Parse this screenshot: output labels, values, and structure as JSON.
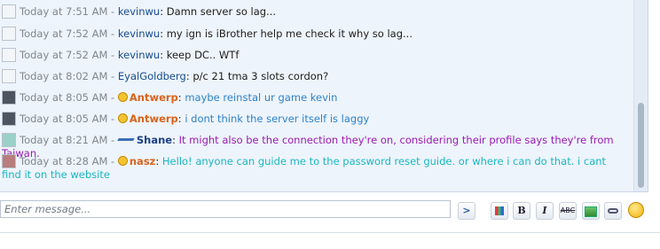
{
  "messages": [
    {
      "time": "Today at 7:51 AM",
      "user": "kevinwu",
      "text": "Damn server so lag..."
    },
    {
      "time": "Today at 7:52 AM",
      "user": "kevinwu",
      "text": "my ign is iBrother help me check it why so lag..."
    },
    {
      "time": "Today at 7:52 AM",
      "user": "kevinwu",
      "text": "keep DC.. WTf"
    },
    {
      "time": "Today at 8:02 AM",
      "user": "EyalGoldberg",
      "text": "p/c 21 tma 3 slots cordon?"
    },
    {
      "time": "Today at 8:05 AM",
      "user": "Antwerp",
      "text": "maybe reinstal ur game kevin"
    },
    {
      "time": "Today at 8:05 AM",
      "user": "Antwerp",
      "text": "i dont think the server itself is laggy"
    },
    {
      "time": "Today at 8:21 AM",
      "user": "Shane",
      "text": "It might also be the connection they're on, considering their profile says they're from Taiwan."
    },
    {
      "time": "Today at 8:28 AM",
      "user": "nasz",
      "text": "Hello! anyone can guide me to the password reset guide. or where i can do that. i cant find it on the website"
    }
  ],
  "separator": " - ",
  "colon": ": ",
  "input": {
    "placeholder": "Enter message..."
  },
  "toolbar": {
    "send_label": ">",
    "bold_label": "B",
    "italic_label": "I",
    "strike_label": "ABC"
  },
  "colors": {
    "panel_bg": "#eef4fb",
    "user_blue": "#154c8d",
    "user_orange": "#d9631b",
    "text_blue": "#2b82c9",
    "text_purple": "#9a1ab3",
    "text_teal": "#18b7c2"
  }
}
